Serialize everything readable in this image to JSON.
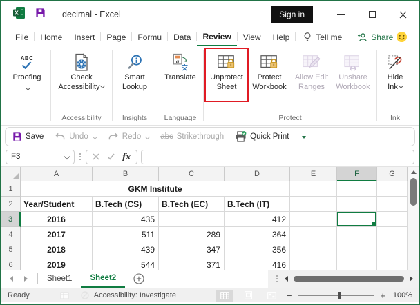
{
  "titlebar": {
    "title": "decimal - Excel",
    "sign_in_label": "Sign in"
  },
  "ribbon_tabs": {
    "items": [
      "File",
      "Home",
      "Insert",
      "Page",
      "Formu",
      "Data",
      "Review",
      "View",
      "Help"
    ],
    "active_tab": "Review",
    "tell_me_label": "Tell me",
    "share_label": "Share"
  },
  "ribbon": {
    "proofing": {
      "icon_text": "ABC",
      "label": "Proofing"
    },
    "check_accessibility": {
      "label_line1": "Check",
      "label_line2": "Accessibility",
      "group_label": "Accessibility"
    },
    "smart_lookup": {
      "label_line1": "Smart",
      "label_line2": "Lookup",
      "group_label": "Insights"
    },
    "translate": {
      "label": "Translate",
      "group_label": "Language"
    },
    "unprotect_sheet": {
      "label_line1": "Unprotect",
      "label_line2": "Sheet",
      "highlighted": true
    },
    "protect_workbook": {
      "label_line1": "Protect",
      "label_line2": "Workbook"
    },
    "allow_edit_ranges": {
      "label_line1": "Allow Edit",
      "label_line2": "Ranges",
      "disabled": true
    },
    "unshare_workbook": {
      "label_line1": "Unshare",
      "label_line2": "Workbook",
      "disabled": true
    },
    "protect_group_label": "Protect",
    "hide_ink": {
      "label_line1": "Hide",
      "label_line2": "Ink",
      "group_label": "Ink"
    }
  },
  "quick_access": {
    "save_label": "Save",
    "undo_label": "Undo",
    "redo_label": "Redo",
    "strikethrough_prefix": "abc",
    "strikethrough_label": "Strikethrough",
    "quick_print_label": "Quick Print"
  },
  "formula_bar": {
    "name_box_value": "F3",
    "fx_label": "fx",
    "formula_value": ""
  },
  "grid": {
    "column_headers": [
      "A",
      "B",
      "C",
      "D",
      "E",
      "F",
      "G"
    ],
    "row_headers": [
      "1",
      "2",
      "3",
      "4",
      "5",
      "6"
    ],
    "selected_cell": "F3",
    "title_cell": "GKM Institute",
    "header_row": [
      "Year/Student",
      "B.Tech (CS)",
      "B.Tech (EC)",
      "B.Tech (IT)"
    ],
    "rows": [
      {
        "year": "2016",
        "cs": "435",
        "ec": "",
        "it": "412"
      },
      {
        "year": "2017",
        "cs": "511",
        "ec": "289",
        "it": "364"
      },
      {
        "year": "2018",
        "cs": "439",
        "ec": "347",
        "it": "356"
      },
      {
        "year": "2019",
        "cs": "544",
        "ec": "371",
        "it": "416"
      }
    ]
  },
  "sheet_tabs": {
    "sheet1_label": "Sheet1",
    "sheet2_label": "Sheet2",
    "active_sheet": "Sheet2"
  },
  "status_bar": {
    "ready_label": "Ready",
    "accessibility_label": "Accessibility: Investigate",
    "zoom_value": "100%"
  },
  "colors": {
    "accent_green": "#107C41",
    "window_border_green": "#217346",
    "highlight_red": "#E01B24",
    "save_purple": "#7719AA",
    "lock_gold": "#D9A33C",
    "icon_blue": "#2E74B5"
  }
}
